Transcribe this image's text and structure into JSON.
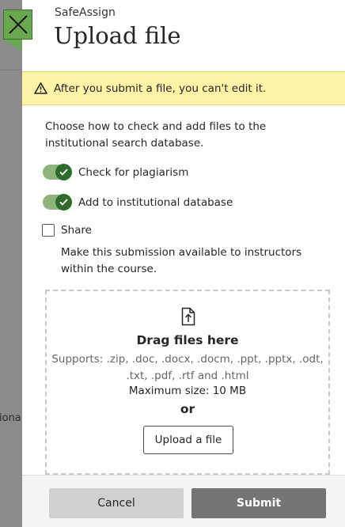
{
  "backdrop": {
    "partial_text": "iona"
  },
  "close": {
    "icon": "close-icon",
    "color": "#6aa84f"
  },
  "header": {
    "app_name": "SafeAssign",
    "title": "Upload file"
  },
  "warning": {
    "icon": "warning-icon",
    "text": "After you submit a file, you can't edit it.",
    "background": "#fdf3a6"
  },
  "intro": "Choose how to check and add files to the institutional search database.",
  "options": {
    "plagiarism": {
      "label": "Check for plagiarism",
      "checked": true
    },
    "institutional": {
      "label": "Add to institutional database",
      "checked": true
    },
    "share": {
      "label": "Share",
      "checked": false,
      "description": "Make this submission available to instructors within the course."
    }
  },
  "dropzone": {
    "icon": "file-upload-icon",
    "title": "Drag files here",
    "supports": "Supports: .zip, .doc, .docx, .docm, .ppt, .pptx, .odt, .txt, .pdf, .rtf and .html",
    "max_size": "Maximum size: 10 MB",
    "or": "or",
    "upload_label": "Upload a file"
  },
  "footer": {
    "cancel_label": "Cancel",
    "submit_label": "Submit"
  },
  "colors": {
    "toggle_track": "#8db47c",
    "toggle_knob": "#2e6b2a",
    "submit_bg": "#747474",
    "cancel_bg": "#d0d0d0"
  }
}
